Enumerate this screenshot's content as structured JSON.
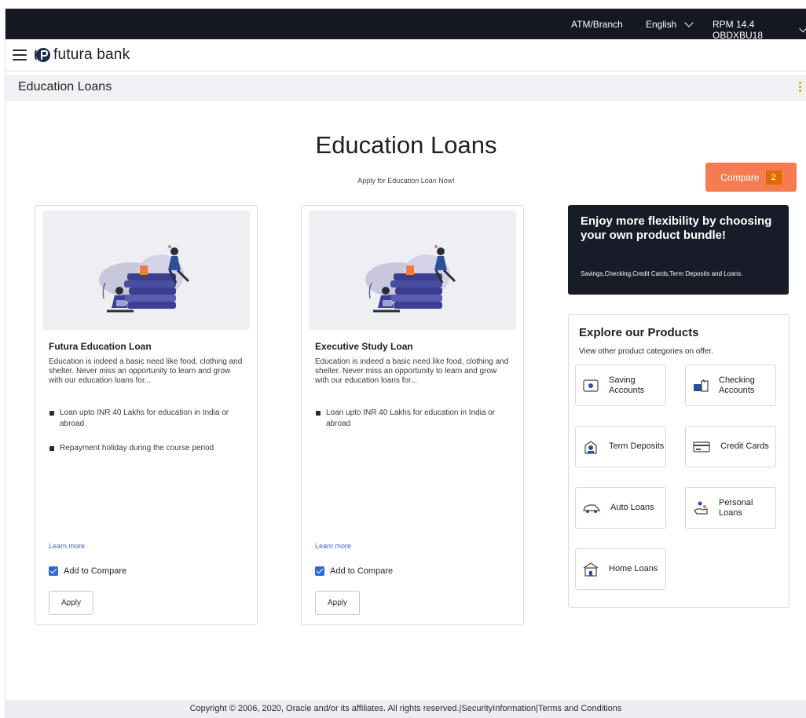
{
  "topbar": {
    "atm_branch": "ATM/Branch",
    "language": "English",
    "user": "RPM 14.4 OBDXBU18"
  },
  "header": {
    "brand": "futura bank"
  },
  "page": {
    "title": "Education Loans",
    "heading": "Education Loans",
    "subheading": "Apply for Education Loan Now!",
    "compare_label": "Compare",
    "compare_count": "2"
  },
  "products": [
    {
      "title": "Futura Education Loan",
      "description": "Education is indeed a basic need like food, clothing and shelter. Never miss an opportunity to learn and grow with our education loans for...",
      "features": [
        "Loan upto INR 40 Lakhs for education in India or abroad",
        "Repayment holiday during the course period"
      ],
      "learn_more": "Learn more",
      "compare_label": "Add to Compare",
      "compare_checked": true,
      "apply_label": "Apply"
    },
    {
      "title": "Executive Study Loan",
      "description": "Education is indeed a basic need like food, clothing and shelter. Never miss an opportunity to learn and grow with our education loans for...",
      "features": [
        "Loan upto INR 40 Lakhs for education in India or abroad"
      ],
      "learn_more": "Learn more",
      "compare_label": "Add to Compare",
      "compare_checked": true,
      "apply_label": "Apply"
    }
  ],
  "promo": {
    "heading": "Enjoy more flexibility by choosing your own product bundle!",
    "text": "Savings,Checking,Credit Cards,Term Deposits and Loans."
  },
  "explore": {
    "heading": "Explore our Products",
    "subheading": "View other product categories on offer.",
    "categories": [
      {
        "label": "Saving Accounts",
        "icon": "saving-accounts-icon"
      },
      {
        "label": "Checking Accounts",
        "icon": "checking-accounts-icon"
      },
      {
        "label": "Term Deposits",
        "icon": "term-deposits-icon"
      },
      {
        "label": "Credit Cards",
        "icon": "credit-cards-icon"
      },
      {
        "label": "Auto Loans",
        "icon": "auto-loans-icon"
      },
      {
        "label": "Personal Loans",
        "icon": "personal-loans-icon"
      },
      {
        "label": "Home Loans",
        "icon": "home-loans-icon"
      }
    ]
  },
  "footer": {
    "text": "Copyright © 2006, 2020, Oracle and/or its affiliates. All rights reserved.|SecurityInformation|Terms and Conditions"
  },
  "colors": {
    "topbar": "#131821",
    "accent": "#f47c50",
    "compare_badge": "#e06a00",
    "link": "#3b61c2",
    "checkbox": "#2d6bd2",
    "promo": "#171c28"
  }
}
